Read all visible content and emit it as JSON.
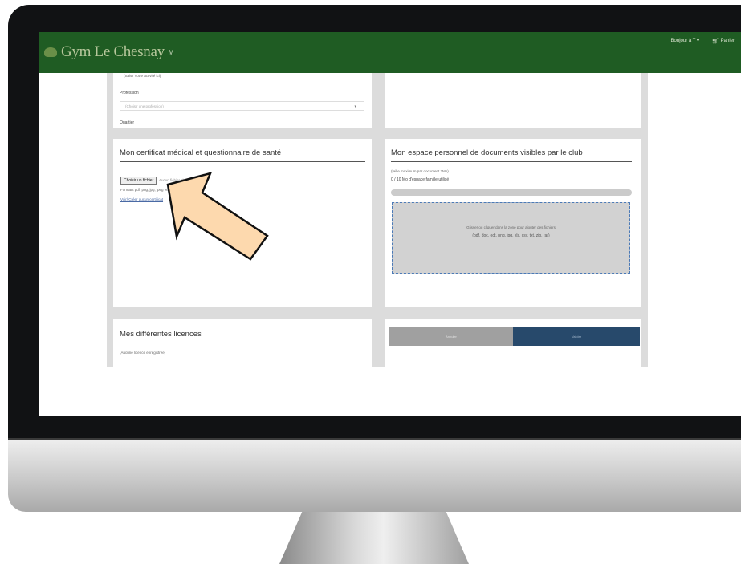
{
  "header": {
    "brand": "Gym Le Chesnay",
    "brand_badge": "M",
    "user_menu": "Bonjour à T ▾",
    "cart_label": "Panier",
    "cart_icon": "cart-icon",
    "bg_color": "#1f5c23"
  },
  "profile_panel": {
    "field_hint": "(Saisir votre activité ici)",
    "profession_label": "Profession",
    "profession_placeholder": "(Choisir une profession)",
    "next_label": "Quartier"
  },
  "medical_panel": {
    "title": "Mon certificat médical et questionnaire de santé",
    "file_button": "Choisir un fichier",
    "file_status": "Aucun fichier choisi",
    "formats": "Formats pdf, png, jpg, jpeg etc.",
    "link": "Voir/ Créer aucun certificat"
  },
  "documents_panel": {
    "title": "Mon espace personnel de documents visibles par le club",
    "size_note": "(taille maximum par document 2Mo)",
    "usage": "0 / 10 Mo d'espace famille utilisé",
    "usage_fraction": 0.0,
    "drop_hint": "Glisser ou cliquer dans la zone pour ajouter des fichiers",
    "drop_formats": "(pdf, doc, odt, png, jpg, xls, csv, txt, zip, rar)"
  },
  "licences_panel": {
    "title": "Mes différentes licences",
    "empty_text": "(Aucune licence enregistrée)"
  },
  "actions_panel": {
    "left_button": "Annuler",
    "right_button": "Valider"
  },
  "colors": {
    "pointer_arrow": "#fdd9ae",
    "accent_blue": "#27496b"
  }
}
